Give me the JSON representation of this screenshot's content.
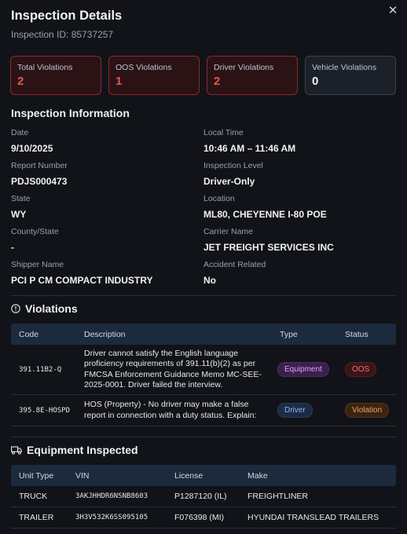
{
  "header": {
    "title": "Inspection Details",
    "inspection_id": "Inspection ID: 85737257",
    "close_glyph": "✕"
  },
  "summary": [
    {
      "label": "Total Violations",
      "value": "2",
      "tone": "red"
    },
    {
      "label": "OOS Violations",
      "value": "1",
      "tone": "red"
    },
    {
      "label": "Driver Violations",
      "value": "2",
      "tone": "red"
    },
    {
      "label": "Vehicle Violations",
      "value": "0",
      "tone": "gray"
    }
  ],
  "inspection_info": {
    "title": "Inspection Information",
    "fields": [
      {
        "label": "Date",
        "value": "9/10/2025"
      },
      {
        "label": "Local Time",
        "value": "10:46 AM – 11:46 AM"
      },
      {
        "label": "Report Number",
        "value": "PDJS000473"
      },
      {
        "label": "Inspection Level",
        "value": "Driver-Only"
      },
      {
        "label": "State",
        "value": "WY"
      },
      {
        "label": "Location",
        "value": "ML80, CHEYENNE I-80 POE"
      },
      {
        "label": "County/State",
        "value": "-"
      },
      {
        "label": "Carrier Name",
        "value": "JET FREIGHT SERVICES INC"
      },
      {
        "label": "Shipper Name",
        "value": "PCI P CM COMPACT INDUSTRY"
      },
      {
        "label": "Accident Related",
        "value": "No"
      }
    ]
  },
  "violations": {
    "title": "Violations",
    "icon": "info-circle-icon",
    "columns": [
      "Code",
      "Description",
      "Type",
      "Status"
    ],
    "rows": [
      {
        "code": "391.11B2-Q",
        "description": "Driver cannot satisfy the English language proficiency requirements of 391.11(b)(2) as per FMCSA Enforcement Guidance Memo MC-SEE-2025-0001. Driver failed the interview.",
        "type": "Equipment",
        "status": "OOS"
      },
      {
        "code": "395.8E-HOSPD",
        "description": "HOS (Property) - No driver may make a false report in connection with a duty status. Explain:",
        "type": "Driver",
        "status": "Violation"
      }
    ]
  },
  "equipment": {
    "title": "Equipment Inspected",
    "icon": "truck-icon",
    "columns": [
      "Unit Type",
      "VIN",
      "License",
      "Make"
    ],
    "rows": [
      {
        "unit_type": "TRUCK",
        "vin": "3AKJHHDR6NSNB8603",
        "license": "P1287120 (IL)",
        "make": "FREIGHTLINER"
      },
      {
        "unit_type": "TRAILER",
        "vin": "3H3V532K6SS095105",
        "license": "F076398 (MI)",
        "make": "HYUNDAI TRANSLEAD TRAILERS"
      }
    ]
  },
  "colors": {
    "background": "#111318",
    "alert_red": "#ef5350",
    "table_header": "#1c2a3d"
  }
}
